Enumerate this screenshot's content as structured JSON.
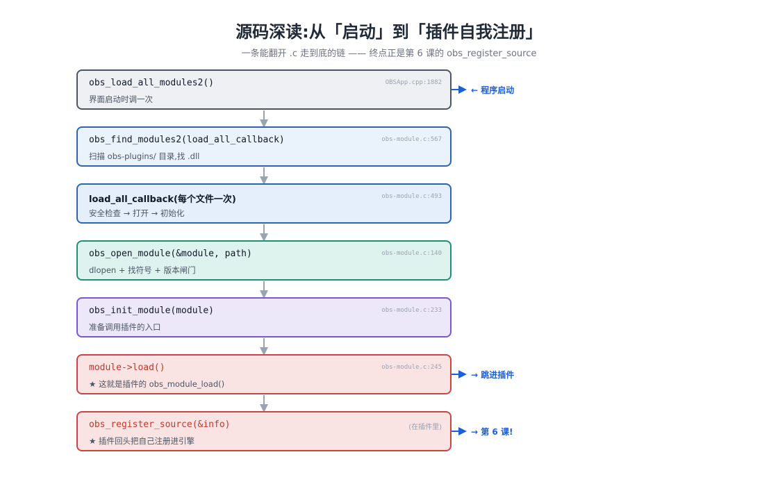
{
  "header": {
    "title": "源码深读:从「启动」到「插件自我注册」",
    "subtitle": "一条能翻开 .c 走到底的链 —— 终点正是第 6 课的 obs_register_source"
  },
  "steps": [
    {
      "func": "obs_load_all_modules2()",
      "desc": "界面启动时调一次",
      "src": "OBSApp.cpp:1882",
      "note": "← 程序启动"
    },
    {
      "func": "obs_find_modules2(load_all_callback)",
      "desc": "扫描 obs-plugins/ 目录,找 .dll",
      "src": "obs-module.c:567",
      "note": ""
    },
    {
      "func": "load_all_callback(每个文件一次)",
      "desc": "安全检查 → 打开 → 初始化",
      "src": "obs-module.c:493",
      "note": ""
    },
    {
      "func": "obs_open_module(&module, path)",
      "desc": "dlopen + 找符号 + 版本闸门",
      "src": "obs-module.c:140",
      "note": ""
    },
    {
      "func": "obs_init_module(module)",
      "desc": "准备调用插件的入口",
      "src": "obs-module.c:233",
      "note": ""
    },
    {
      "func": "module->load()",
      "desc": "★ 这就是插件的 obs_module_load()",
      "src": "obs-module.c:245",
      "note": "→ 跳进插件"
    },
    {
      "func": "obs_register_source(&info)",
      "desc": "★ 插件回头把自己注册进引擎",
      "src": "(在插件里)",
      "note": "→ 第 6 课!"
    }
  ],
  "colors": {
    "arrow": "#9aa3b0",
    "note_arrow": "#1d5fd6"
  }
}
